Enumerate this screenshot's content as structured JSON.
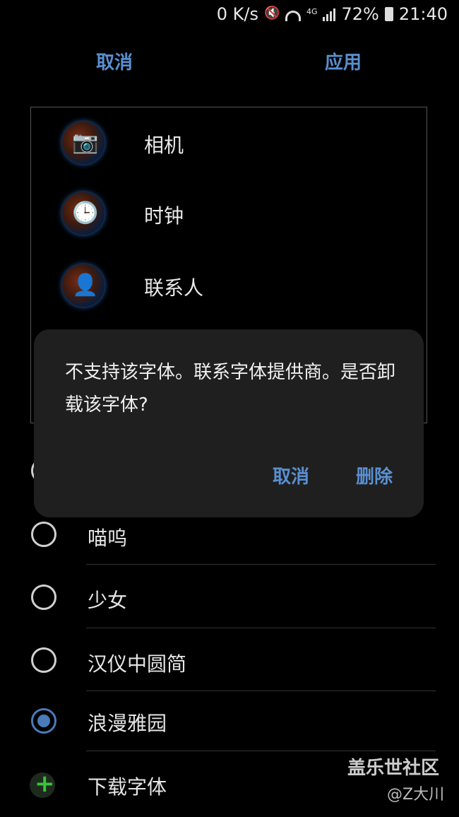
{
  "status_bar": {
    "net_speed": "0 K/s",
    "network": "4G",
    "battery": "72%",
    "time": "21:40"
  },
  "header": {
    "cancel_label": "取消",
    "apply_label": "应用"
  },
  "preview": {
    "apps": [
      {
        "label": "相机",
        "icon": "camera-icon"
      },
      {
        "label": "时钟",
        "icon": "clock-icon"
      },
      {
        "label": "联系人",
        "icon": "contacts-icon"
      }
    ]
  },
  "dialog": {
    "message": "不支持该字体。联系字体提供商。是否卸载该字体?",
    "cancel_label": "取消",
    "delete_label": "删除"
  },
  "fonts": {
    "items": [
      {
        "label": "喵呜",
        "selected": false
      },
      {
        "label": "少女",
        "selected": false
      },
      {
        "label": "汉仪中圆简",
        "selected": false
      },
      {
        "label": "浪漫雅园",
        "selected": true
      }
    ],
    "download_label": "下载字体"
  },
  "watermark": {
    "site": "盖乐世社区",
    "author": "@Z大川"
  },
  "colors": {
    "accent": "#5a8fd0",
    "radio_selected": "#4a7ab8",
    "dialog_bg": "#1f1f1f",
    "plus_green": "#3ac23a"
  }
}
